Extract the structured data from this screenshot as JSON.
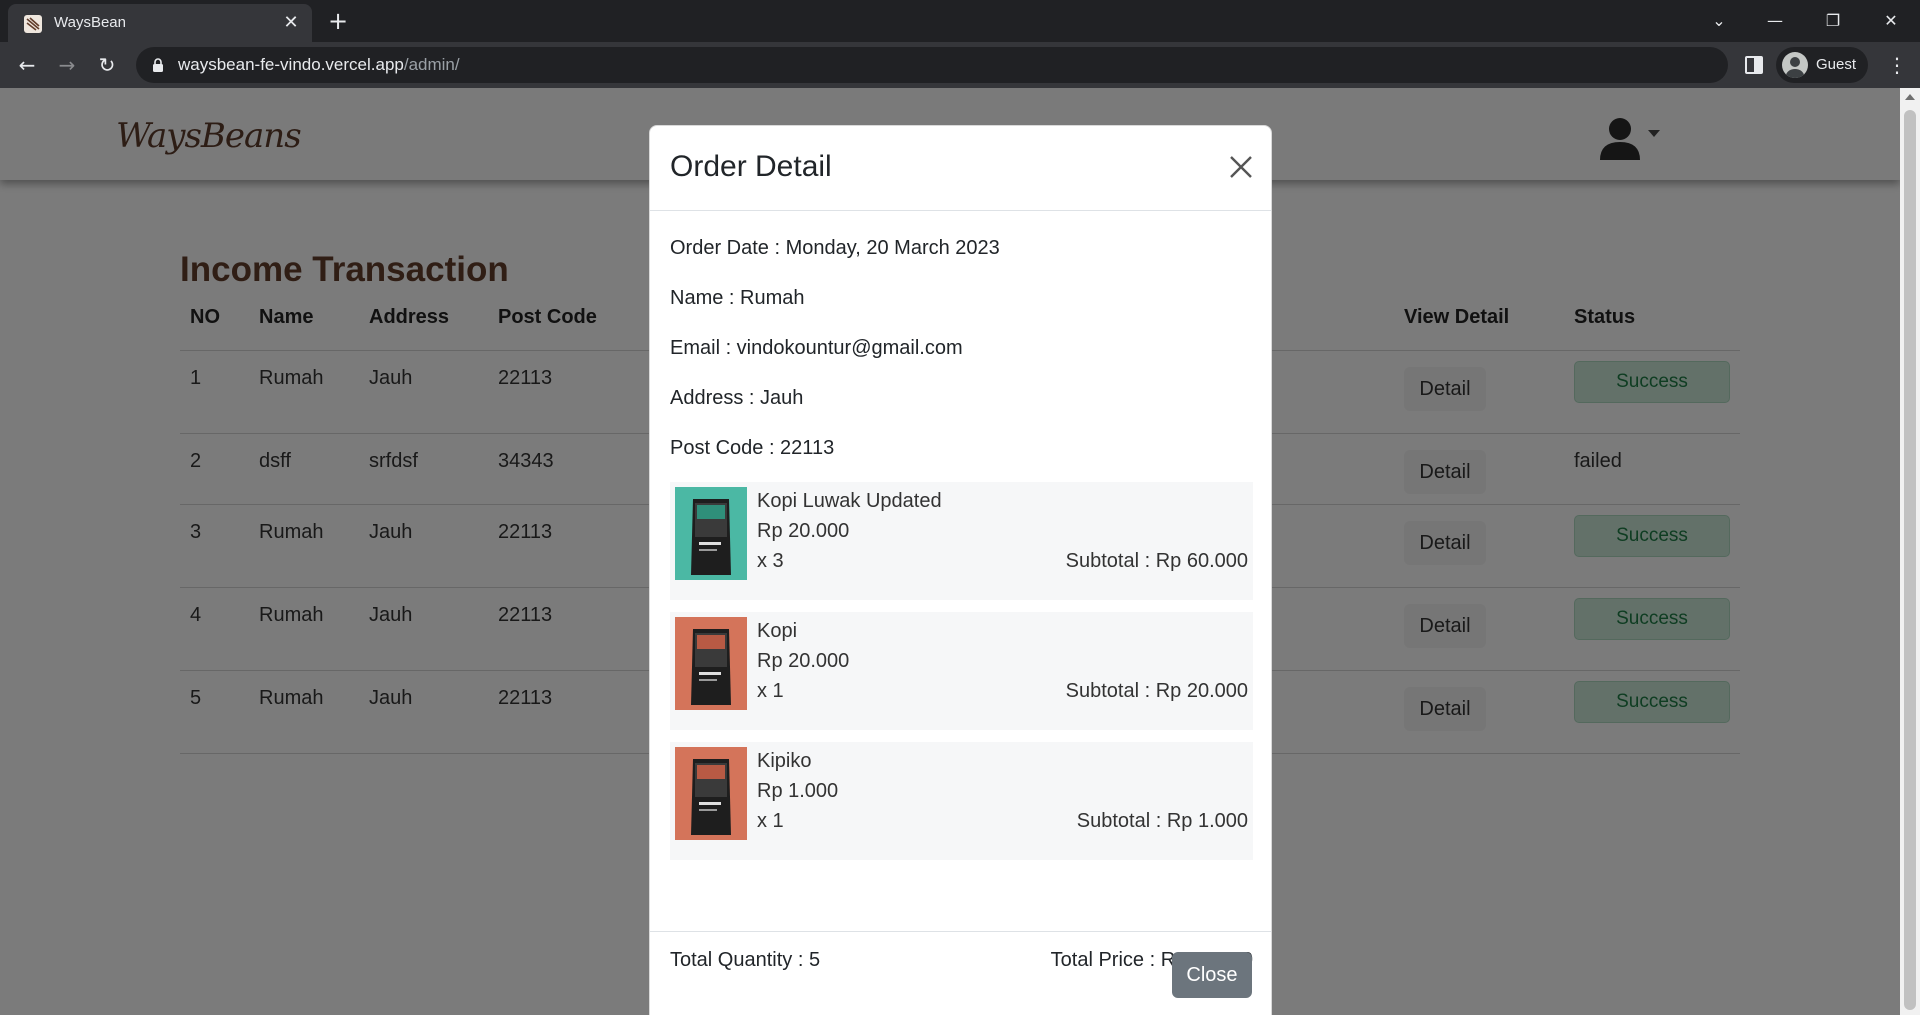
{
  "browser": {
    "tab_title": "WaysBean",
    "url_host": "waysbean-fe-vindo.vercel.app",
    "url_path": "/admin/",
    "profile_name": "Guest"
  },
  "navbar": {
    "logo_text": "WaysBeans"
  },
  "page": {
    "title": "Income Transaction",
    "columns": [
      "NO",
      "Name",
      "Address",
      "Post Code",
      "View Detail",
      "Status"
    ],
    "rows": [
      {
        "no": "1",
        "name": "Rumah",
        "address": "Jauh",
        "post_code": "22113",
        "detail_label": "Detail",
        "status": "Success"
      },
      {
        "no": "2",
        "name": "dsff",
        "address": "srfdsf",
        "post_code": "34343",
        "detail_label": "Detail",
        "status": "failed"
      },
      {
        "no": "3",
        "name": "Rumah",
        "address": "Jauh",
        "post_code": "22113",
        "detail_label": "Detail",
        "status": "Success"
      },
      {
        "no": "4",
        "name": "Rumah",
        "address": "Jauh",
        "post_code": "22113",
        "detail_label": "Detail",
        "status": "Success"
      },
      {
        "no": "5",
        "name": "Rumah",
        "address": "Jauh",
        "post_code": "22113",
        "detail_label": "Detail",
        "status": "Success"
      }
    ]
  },
  "modal": {
    "title": "Order Detail",
    "order_date": "Order Date : Monday, 20 March 2023",
    "name": "Name : Rumah",
    "email": "Email : vindokountur@gmail.com",
    "address": "Address : Jauh",
    "post_code": "Post Code : 22113",
    "items": [
      {
        "name": "Kopi Luwak Updated",
        "price": "Rp 20.000",
        "qty": "x 3",
        "subtotal": "Subtotal : Rp 60.000",
        "image_bg": "#4bb8a4"
      },
      {
        "name": "Kopi",
        "price": "Rp 20.000",
        "qty": "x 1",
        "subtotal": "Subtotal : Rp 20.000",
        "image_bg": "#d4745a"
      },
      {
        "name": "Kipiko",
        "price": "Rp 1.000",
        "qty": "x 1",
        "subtotal": "Subtotal : Rp 1.000",
        "image_bg": "#d4745a"
      }
    ],
    "total_quantity": "Total Quantity : 5",
    "total_price": "Total Price : Rp 81.000",
    "close_label": "Close"
  },
  "colors": {
    "brand_brown": "#613d2b",
    "success_bg": "#c6e2d3",
    "success_text": "#1f7a45",
    "close_btn": "#6c757d"
  },
  "icons": [
    "favicon-icon",
    "close-tab-icon",
    "new-tab-icon",
    "back-icon",
    "forward-icon",
    "reload-icon",
    "lock-icon",
    "side-panel-icon",
    "guest-avatar-icon",
    "menu-dots-icon",
    "user-avatar-icon",
    "modal-close-icon"
  ]
}
